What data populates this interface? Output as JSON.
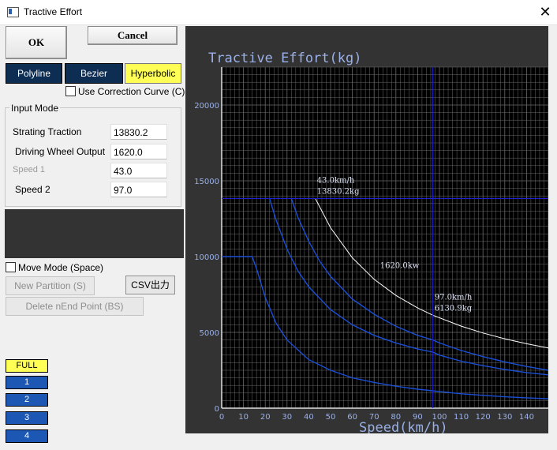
{
  "window": {
    "title": "Tractive Effort",
    "close_glyph": "✕"
  },
  "buttons": {
    "ok": "OK",
    "cancel": "Cancel"
  },
  "curve_tabs": [
    {
      "label": "Polyline",
      "active": false
    },
    {
      "label": "Bezier",
      "active": false
    },
    {
      "label": "Hyperbolic",
      "active": true
    }
  ],
  "correction_label": "Use Correction Curve (C)",
  "input_mode": {
    "title": "Input Mode",
    "fields": [
      {
        "label": "Strating Traction",
        "value": "13830.2",
        "disabled": false
      },
      {
        "label": "Driving Wheel Output",
        "value": "1620.0",
        "disabled": false
      },
      {
        "label": "Speed 1",
        "value": "43.0",
        "disabled": true
      },
      {
        "label": "Speed 2",
        "value": "97.0",
        "disabled": false
      }
    ]
  },
  "move_mode_label": "Move Mode (Space)",
  "actions": {
    "new_partition": "New Partition (S)",
    "csv": "CSV出力",
    "delete_end_point": "Delete nEnd Point (BS)"
  },
  "levels": [
    "FULL",
    "1",
    "2",
    "3",
    "4"
  ],
  "colors": {
    "graph_bg": "#333333",
    "grid": "#6a6a6a",
    "curve": "#1a4fd6",
    "active_curve": "#ffffff",
    "cursor": "#2222cc",
    "axis_text": "#9ab0e8"
  },
  "chart_data": {
    "type": "line",
    "title": "Tractive Effort(kg)",
    "xlabel": "Speed(km/h)",
    "xlim": [
      0,
      150
    ],
    "ylim": [
      0,
      22500
    ],
    "xticks": [
      0,
      10,
      20,
      30,
      40,
      50,
      60,
      70,
      80,
      90,
      100,
      110,
      120,
      130,
      140
    ],
    "yticks": [
      0,
      5000,
      10000,
      15000,
      20000
    ],
    "grid": true,
    "cursor": {
      "x": 97,
      "y": 13830.2
    },
    "annotations": [
      {
        "x": 43,
        "y": 13830.2,
        "lines": [
          "43.0km/h",
          "13830.2kg"
        ]
      },
      {
        "x": 72,
        "y": 9250,
        "lines": [
          "1620.0kw"
        ]
      },
      {
        "x": 97,
        "y": 6130.9,
        "lines": [
          "97.0km/h",
          "6130.9kg"
        ]
      }
    ],
    "series": [
      {
        "points": [
          [
            0,
            13830.2
          ],
          [
            43,
            13830.2
          ],
          [
            50,
            11900
          ],
          [
            60,
            9920
          ],
          [
            70,
            8500
          ],
          [
            80,
            7440
          ],
          [
            90,
            6610
          ],
          [
            97,
            6130.9
          ],
          [
            110,
            5410
          ],
          [
            120,
            4960
          ],
          [
            130,
            4580
          ],
          [
            140,
            4250
          ],
          [
            150,
            3970
          ]
        ]
      },
      {
        "points": [
          [
            22,
            13830.2
          ],
          [
            25,
            12400
          ],
          [
            30,
            10500
          ],
          [
            35,
            9050
          ],
          [
            40,
            8000
          ],
          [
            50,
            6500
          ],
          [
            60,
            5500
          ],
          [
            70,
            4800
          ],
          [
            80,
            4300
          ],
          [
            90,
            3900
          ],
          [
            97,
            3700
          ],
          [
            100,
            3500
          ],
          [
            110,
            3100
          ],
          [
            120,
            2800
          ],
          [
            130,
            2550
          ],
          [
            140,
            2350
          ],
          [
            150,
            2200
          ]
        ]
      },
      {
        "points": [
          [
            32,
            13830.2
          ],
          [
            35,
            12600
          ],
          [
            40,
            11000
          ],
          [
            45,
            9700
          ],
          [
            50,
            8700
          ],
          [
            60,
            7200
          ],
          [
            70,
            6200
          ],
          [
            80,
            5400
          ],
          [
            90,
            4800
          ],
          [
            97,
            4500
          ],
          [
            100,
            4300
          ],
          [
            110,
            3800
          ],
          [
            120,
            3400
          ],
          [
            130,
            3050
          ],
          [
            140,
            2750
          ],
          [
            150,
            2500
          ]
        ]
      },
      {
        "points": [
          [
            0,
            10000
          ],
          [
            14,
            10000
          ],
          [
            16,
            9200
          ],
          [
            20,
            7300
          ],
          [
            25,
            5600
          ],
          [
            30,
            4500
          ],
          [
            40,
            3200
          ],
          [
            50,
            2500
          ],
          [
            60,
            2000
          ],
          [
            70,
            1700
          ],
          [
            80,
            1450
          ],
          [
            90,
            1250
          ],
          [
            100,
            1100
          ],
          [
            110,
            950
          ],
          [
            120,
            850
          ],
          [
            130,
            750
          ],
          [
            140,
            680
          ],
          [
            150,
            620
          ]
        ]
      }
    ]
  }
}
